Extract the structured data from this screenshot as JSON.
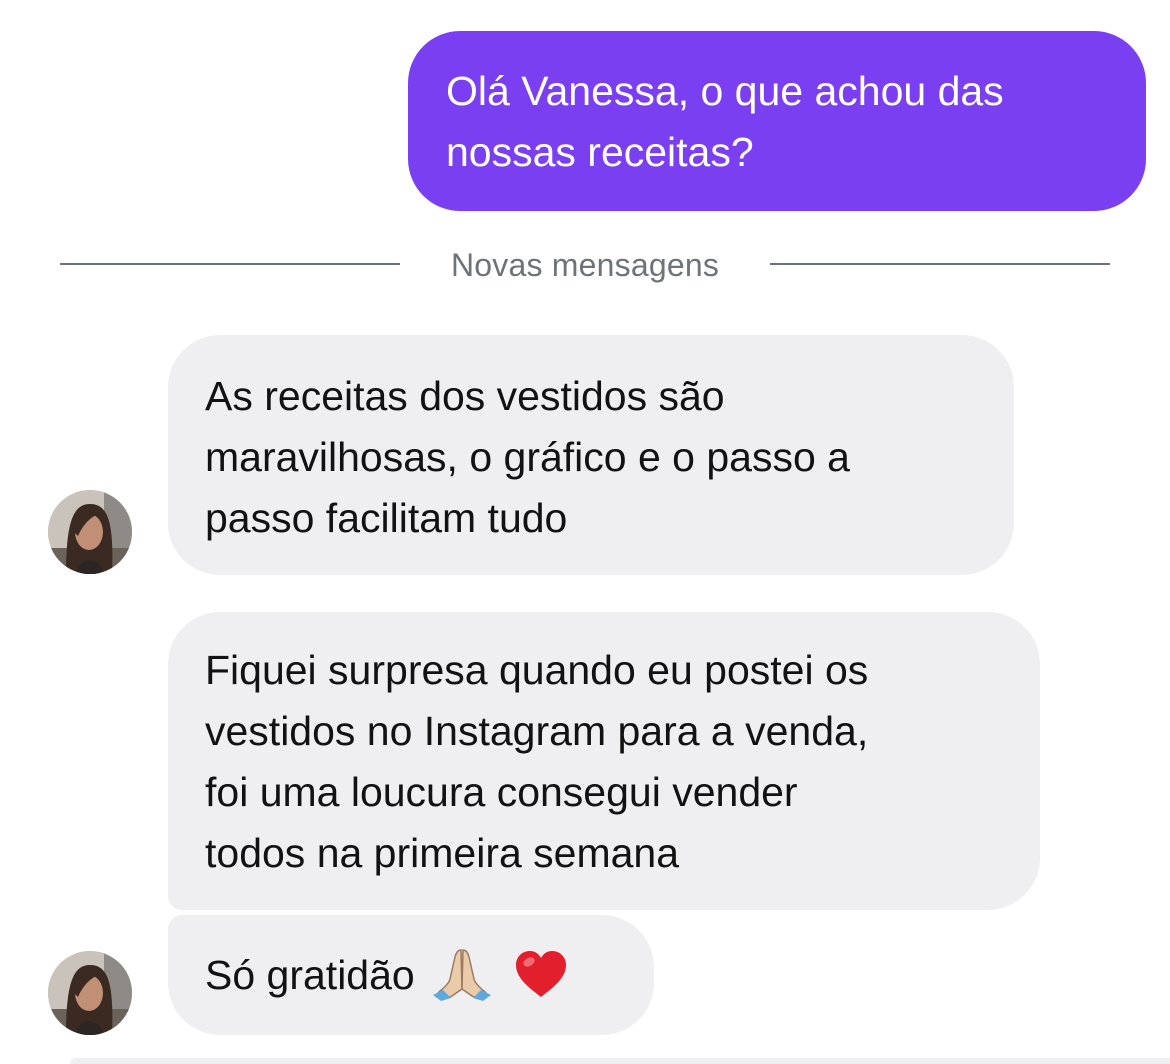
{
  "conversation": {
    "outgoing": {
      "lines": [
        "Olá Vanessa, o que achou das",
        "nossas receitas?"
      ],
      "color": "#7b3ff2"
    },
    "divider": {
      "label": "Novas mensagens"
    },
    "incoming": [
      {
        "lines": [
          "As receitas dos vestidos são",
          "maravilhosas, o gráfico e o passo a",
          "passo facilitam tudo"
        ]
      },
      {
        "lines": [
          "Fiquei surpresa quando eu postei os",
          "vestidos no Instagram para a venda,",
          "foi uma loucura consegui vender",
          "todos na primeira semana"
        ]
      },
      {
        "text": "Só gratidão",
        "emojis": [
          "folded-hands-icon",
          "red-heart-icon"
        ]
      }
    ],
    "incoming_bubble_color": "#efeff2"
  }
}
